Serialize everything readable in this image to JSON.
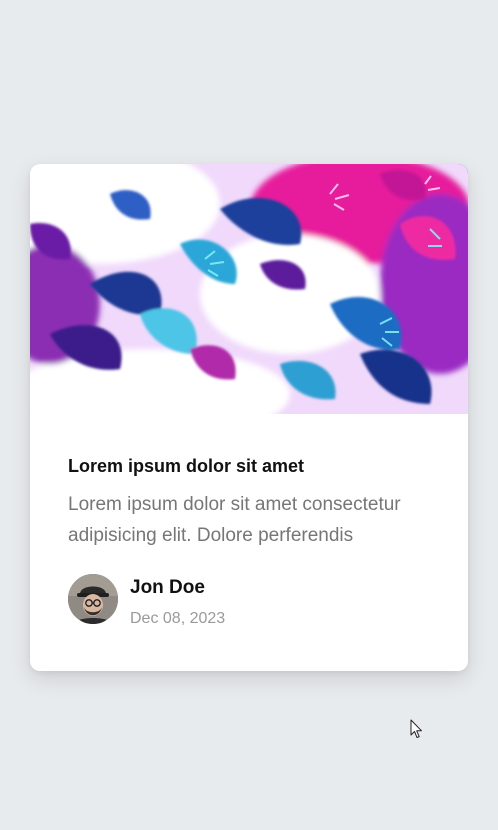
{
  "card": {
    "image": {
      "alt": "abstract-floral-painting",
      "colors": [
        "#ffffff",
        "#f3d6ff",
        "#e21a9e",
        "#1e6fbf",
        "#27c0dc",
        "#2b1a7a",
        "#c54ce0"
      ]
    },
    "title": "Lorem ipsum dolor sit amet",
    "description": "Lorem ipsum dolor sit amet consectetur adipisicing elit. Dolore perferendis",
    "author": {
      "name": "Jon Doe",
      "date": "Dec 08, 2023",
      "avatar_icon": "avatar-photo-icon"
    }
  },
  "cursor": {
    "icon": "mouse-pointer-icon"
  }
}
